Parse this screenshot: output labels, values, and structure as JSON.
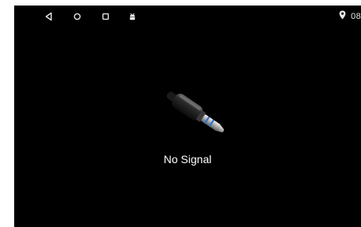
{
  "status_bar": {
    "nav_icons": [
      "back-icon",
      "home-icon",
      "recents-icon",
      "android-icon"
    ],
    "location_icon": "location-pin-icon",
    "clock": "08"
  },
  "main": {
    "image_icon": "audio-jack-plug-icon",
    "message": "No Signal"
  },
  "colors": {
    "background": "#000000",
    "text": "#ffffff",
    "accent_cable": "#2f73c9"
  }
}
